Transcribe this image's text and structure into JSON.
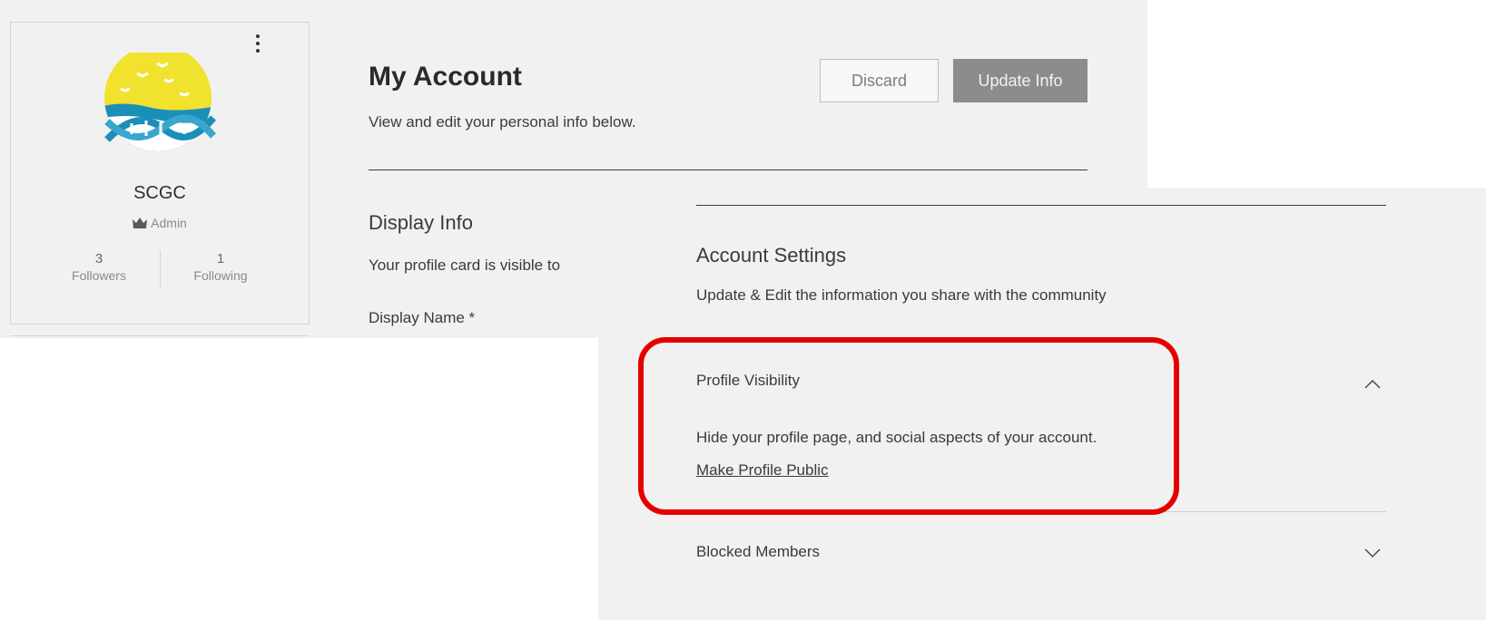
{
  "profile": {
    "name": "SCGC",
    "role": "Admin",
    "followers_count": "3",
    "followers_label": "Followers",
    "following_count": "1",
    "following_label": "Following",
    "avatar_colors": {
      "sun": "#f1e22e",
      "sea": "#1a8fb8",
      "dna": "#3aa6cf"
    }
  },
  "header": {
    "title": "My Account",
    "subtitle": "View and edit your personal info below.",
    "discard_label": "Discard",
    "update_label": "Update Info"
  },
  "display_info": {
    "title": "Display Info",
    "description": "Your profile card is visible to",
    "display_name_label": "Display Name *"
  },
  "account_settings": {
    "title": "Account Settings",
    "description": "Update & Edit the information you share with the community",
    "sections": [
      {
        "title": "Profile Visibility",
        "expanded": true,
        "description": "Hide your profile page, and social aspects of your account.",
        "action_label": "Make Profile Public"
      },
      {
        "title": "Blocked Members",
        "expanded": false
      }
    ]
  },
  "annotation": {
    "highlight_color": "#e50000"
  }
}
